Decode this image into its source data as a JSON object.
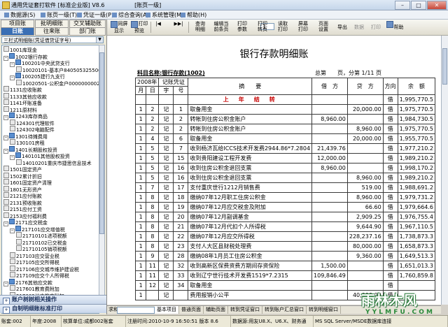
{
  "window": {
    "title": "通用凭证套打软件 [标准企业版] V8.6 　　　　　[账页一级]",
    "minimize": "–",
    "maximize": "□",
    "close": "✕"
  },
  "menu": [
    {
      "label": "数据源(S)"
    },
    {
      "label": "账页一级(T)"
    },
    {
      "label": "凭证一级(P)"
    },
    {
      "label": "综合查询(A)"
    },
    {
      "label": "系统管理(M)"
    },
    {
      "label": "帮助(H)"
    }
  ],
  "left": {
    "tabs": [
      "项目账",
      "批明细账",
      "交叉辅助账",
      "日账",
      "往来账",
      "部门账"
    ],
    "combo": "三栏式明细账(凭证借贷证字号)",
    "tree": [
      {
        "text": "1001库现金",
        "indent": 0,
        "box": "",
        "icon": "leaf"
      },
      {
        "text": "1002银行存款",
        "indent": 0,
        "box": "-",
        "icon": "node"
      },
      {
        "text": "100201中央武贷支行",
        "indent": 1,
        "box": "-",
        "icon": "node"
      },
      {
        "text": "10020101-基本户840505325500",
        "indent": 2,
        "box": "",
        "icon": "leaf"
      },
      {
        "text": "100205建行九支行",
        "indent": 1,
        "box": "-",
        "icon": "node"
      },
      {
        "text": "10020501-公积金户0000000002",
        "indent": 2,
        "box": "",
        "icon": "leaf"
      },
      {
        "text": "1131应收账款",
        "indent": 0,
        "box": "",
        "icon": "leaf"
      },
      {
        "text": "1133其他应收款",
        "indent": 0,
        "box": "",
        "icon": "leaf"
      },
      {
        "text": "1141坏账准备",
        "indent": 0,
        "box": "",
        "icon": "leaf"
      },
      {
        "text": "1211原材料",
        "indent": 0,
        "box": "",
        "icon": "leaf"
      },
      {
        "text": "1243库存商品",
        "indent": 0,
        "box": "-",
        "icon": "node"
      },
      {
        "text": "124301代理软件",
        "indent": 1,
        "box": "",
        "icon": "leaf"
      },
      {
        "text": "124302电脑配件",
        "indent": 1,
        "box": "",
        "icon": "leaf"
      },
      {
        "text": "1301待摊费用",
        "indent": 0,
        "box": "-",
        "icon": "node"
      },
      {
        "text": "130101房租",
        "indent": 1,
        "box": "",
        "icon": "leaf"
      },
      {
        "text": "1401长期股权投资",
        "indent": 0,
        "box": "-",
        "icon": "node"
      },
      {
        "text": "140101其他股权投资",
        "indent": 1,
        "box": "-",
        "icon": "node"
      },
      {
        "text": "14010201重庆市捷思信息技术",
        "indent": 2,
        "box": "",
        "icon": "leaf"
      },
      {
        "text": "1501固定资产",
        "indent": 0,
        "box": "",
        "icon": "leaf"
      },
      {
        "text": "1502累计折旧",
        "indent": 0,
        "box": "",
        "icon": "leaf"
      },
      {
        "text": "1601固定资产清理",
        "indent": 0,
        "box": "",
        "icon": "leaf"
      },
      {
        "text": "1801无形资产",
        "indent": 0,
        "box": "",
        "icon": "leaf"
      },
      {
        "text": "2121应付账款",
        "indent": 0,
        "box": "",
        "icon": "leaf"
      },
      {
        "text": "2131预收账款",
        "indent": 0,
        "box": "",
        "icon": "leaf"
      },
      {
        "text": "2151应付工资",
        "indent": 0,
        "box": "",
        "icon": "leaf"
      },
      {
        "text": "2153应付福利费",
        "indent": 0,
        "box": "",
        "icon": "leaf"
      },
      {
        "text": "2171应交税金",
        "indent": 0,
        "box": "-",
        "icon": "node"
      },
      {
        "text": "217101应交增值税",
        "indent": 1,
        "box": "-",
        "icon": "node"
      },
      {
        "text": "21710101进项税额",
        "indent": 2,
        "box": "",
        "icon": "leaf"
      },
      {
        "text": "21710102已交税金",
        "indent": 2,
        "box": "",
        "icon": "leaf"
      },
      {
        "text": "21710105销项税额",
        "indent": 2,
        "box": "",
        "icon": "leaf"
      },
      {
        "text": "217103应交营业税",
        "indent": 1,
        "box": "",
        "icon": "leaf"
      },
      {
        "text": "217105应交所得税",
        "indent": 1,
        "box": "",
        "icon": "leaf"
      },
      {
        "text": "217106应交城市维护建设税",
        "indent": 1,
        "box": "",
        "icon": "leaf"
      },
      {
        "text": "217109应交个人所得税",
        "indent": 1,
        "box": "",
        "icon": "leaf"
      },
      {
        "text": "2176其他应交款",
        "indent": 0,
        "box": "-",
        "icon": "node"
      },
      {
        "text": "217601教育费附加",
        "indent": 1,
        "box": "",
        "icon": "leaf"
      },
      {
        "text": "217602地方教育附加",
        "indent": 1,
        "box": "",
        "icon": "leaf"
      },
      {
        "text": "217603堤防维护费",
        "indent": 1,
        "box": "",
        "icon": "leaf"
      },
      {
        "text": "217604副食品价格调节基金",
        "indent": 1,
        "box": "",
        "icon": "leaf"
      }
    ],
    "panel_bottom": [
      "账户树树相关操作",
      "自制明细账标准打印"
    ]
  },
  "toolbar": {
    "buttons": [
      {
        "label": "同屏\n显示",
        "dis": false
      },
      {
        "label": "打印\n预览",
        "dis": false
      },
      {
        "label": "查询\n明细",
        "dis": false
      },
      {
        "label": "编辑当\n前条页",
        "dis": false
      },
      {
        "label": "打印\n参数",
        "dis": false
      },
      {
        "label": "打印\n转页",
        "dis": false
      },
      {
        "label": "读取\n打印",
        "dis": false
      },
      {
        "label": "屏幕\n打印",
        "dis": false
      },
      {
        "label": "页面\n设置",
        "dis": false
      },
      {
        "label": "导出",
        "dis": false
      },
      {
        "label": "数据",
        "dis": true
      },
      {
        "label": "打印",
        "dis": true
      },
      {
        "label": "帮助",
        "dis": false
      }
    ],
    "page": "1"
  },
  "report": {
    "title": "银行存款明细账",
    "subject": "科目名称:银行存款(1002)",
    "total_pages": "总第　　页，分第 1/11 页",
    "headers": {
      "year": "2008年",
      "voucher": "记账凭证",
      "month": "月",
      "day": "日",
      "type": "字",
      "num": "号",
      "summary": "摘　　要",
      "debit": "借　方",
      "credit": "贷　方",
      "dir": "方向",
      "balance": "余　额"
    },
    "rows": [
      {
        "m": "",
        "d": "",
        "t": "",
        "n": "",
        "s": "上　年　结　转",
        "dr": "",
        "cr": "",
        "dir": "借",
        "bal": "1,995,770.5",
        "red": true
      },
      {
        "m": "1",
        "d": "2",
        "t": "记",
        "n": "1",
        "s": "取备用金",
        "dr": "",
        "cr": "20,000.00",
        "dir": "借",
        "bal": "1,975,770.5"
      },
      {
        "m": "1",
        "d": "2",
        "t": "记",
        "n": "2",
        "s": "转帐到住房公积金账户",
        "dr": "8,960.00",
        "cr": "",
        "dir": "借",
        "bal": "1,984,730.5"
      },
      {
        "m": "1",
        "d": "2",
        "t": "记",
        "n": "2",
        "s": "转帐到住房公积金账户",
        "dr": "",
        "cr": "8,960.00",
        "dir": "借",
        "bal": "1,975,770.5"
      },
      {
        "m": "1",
        "d": "4",
        "t": "记",
        "n": "6",
        "s": "取备用金",
        "dr": "",
        "cr": "20,000.00",
        "dir": "借",
        "bal": "1,955,770.5"
      },
      {
        "m": "1",
        "d": "5",
        "t": "记",
        "n": "7",
        "s": "收到杨济瓦给ICCS技术开发费2944.86*7.2804",
        "dr": "21,439.76",
        "cr": "",
        "dir": "借",
        "bal": "1,977,210.2"
      },
      {
        "m": "1",
        "d": "5",
        "t": "记",
        "n": "15",
        "s": "收到贵阳建设工程开发费",
        "dr": "12,000.00",
        "cr": "",
        "dir": "借",
        "bal": "1,989,210.2"
      },
      {
        "m": "1",
        "d": "5",
        "t": "记",
        "n": "16",
        "s": "收到住房公积金退回支票",
        "dr": "8,960.00",
        "cr": "",
        "dir": "借",
        "bal": "1,998,170.2"
      },
      {
        "m": "1",
        "d": "5",
        "t": "记",
        "n": "16",
        "s": "收到住房公积金退回支票",
        "dr": "",
        "cr": "8,960.00",
        "dir": "借",
        "bal": "1,989,210.2"
      },
      {
        "m": "1",
        "d": "7",
        "t": "记",
        "n": "17",
        "s": "支付重庆世行1212月销售费",
        "dr": "",
        "cr": "519.00",
        "dir": "借",
        "bal": "1,988,691.2"
      },
      {
        "m": "1",
        "d": "8",
        "t": "记",
        "n": "18",
        "s": "缴纳07年12月职工住房公积金",
        "dr": "",
        "cr": "8,960.00",
        "dir": "借",
        "bal": "1,979,731.2"
      },
      {
        "m": "1",
        "d": "8",
        "t": "记",
        "n": "19",
        "s": "缴纳07年12月应交税金及附加",
        "dr": "",
        "cr": "66.60",
        "dir": "借",
        "bal": "1,979,664.6"
      },
      {
        "m": "1",
        "d": "8",
        "t": "记",
        "n": "20",
        "s": "缴纳07年12月副调基金",
        "dr": "",
        "cr": "2,909.25",
        "dir": "借",
        "bal": "1,976,755.4"
      },
      {
        "m": "1",
        "d": "8",
        "t": "记",
        "n": "21",
        "s": "缴纳07年12月代扣个人所得税",
        "dr": "",
        "cr": "9,644.90",
        "dir": "借",
        "bal": "1,967,110.5"
      },
      {
        "m": "1",
        "d": "8",
        "t": "记",
        "n": "22",
        "s": "缴纳07年12月应交所得税",
        "dr": "",
        "cr": "228,237.16",
        "dir": "借",
        "bal": "1,738,873.3"
      },
      {
        "m": "1",
        "d": "8",
        "t": "记",
        "n": "23",
        "s": "支付人大区县财税处理费",
        "dr": "",
        "cr": "80,000.00",
        "dir": "借",
        "bal": "1,658,873.3"
      },
      {
        "m": "1",
        "d": "9",
        "t": "记",
        "n": "28",
        "s": "缴纳08年1月员工住房公积金",
        "dr": "",
        "cr": "9,360.00",
        "dir": "借",
        "bal": "1,649,513.3"
      },
      {
        "m": "1",
        "d": "11",
        "t": "记",
        "n": "32",
        "s": "收到高新区保费资费方期间存资保险",
        "dr": "1,500.00",
        "cr": "",
        "dir": "借",
        "bal": "1,651,013.3"
      },
      {
        "m": "1",
        "d": "11",
        "t": "记",
        "n": "33",
        "s": "收到辽宁世行技术开发费1519*7.2315",
        "dr": "109,846.49",
        "cr": "",
        "dir": "借",
        "bal": "1,760,859.8"
      },
      {
        "m": "1",
        "d": "12",
        "t": "记",
        "n": "34",
        "s": "取备用金",
        "dr": "",
        "cr": "",
        "dir": "借",
        "bal": ""
      },
      {
        "m": "1",
        "d": "",
        "t": "记",
        "n": "",
        "s": "费用报销小公平",
        "dr": "",
        "cr": "40,000.00",
        "dir": "借",
        "bal": ""
      }
    ]
  },
  "sumbar": {
    "label": "求和",
    "tabs": [
      "基本项目",
      "普通页面",
      "辅助页面",
      "转到凭证窗口",
      "转到账户汇总窗口",
      "转到明细窗口"
    ]
  },
  "status": [
    {
      "text": "账套:002"
    },
    {
      "text": "年度:2008"
    },
    {
      "text": "核算单位:成都002账套"
    },
    {
      "text": "注册时间:2010-10-9 16:50:51 版本 8.6"
    },
    {
      "text": "数据源:用友U8.X、U6.X、财务通"
    },
    {
      "text": "MS SQL Server/MSDE数据库连接"
    }
  ],
  "watermark": {
    "main": "雨林木风",
    "sub": "Y Y L M F U . C O M"
  }
}
